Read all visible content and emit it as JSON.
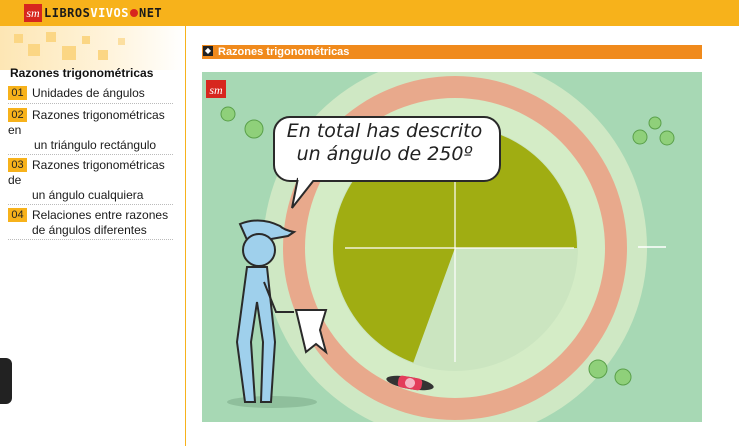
{
  "header": {
    "logo_mark": "sm",
    "logo_prefix": "LIBROS",
    "logo_highlight": "VIVOS",
    "logo_suffix": "NET"
  },
  "sidebar": {
    "title": "Razones trigonométricas",
    "items": [
      {
        "num": "01",
        "lines": [
          "Unidades de ángulos"
        ]
      },
      {
        "num": "02",
        "lines": [
          "Razones trigonométricas",
          "en",
          "   un triángulo rectángulo"
        ]
      },
      {
        "num": "03",
        "lines": [
          "Razones trigonométricas",
          "de",
          "un ángulo cualquiera"
        ]
      },
      {
        "num": "04",
        "lines": [
          "Relaciones entre razones",
          "de ángulos diferentes"
        ]
      }
    ]
  },
  "section": {
    "title": "Razones trigonométricas"
  },
  "scene": {
    "speech_line1": "En total has descrito",
    "speech_line2": "un ángulo de 250º",
    "angle_degrees": 250,
    "badge": "sm"
  },
  "colors": {
    "header": "#f7b21b",
    "section_bar": "#f08a1c",
    "scene_bg": "#a7d8b4",
    "track": "#e8a98c",
    "sector": "#a0ad12",
    "figure": "#9fd0ec"
  }
}
